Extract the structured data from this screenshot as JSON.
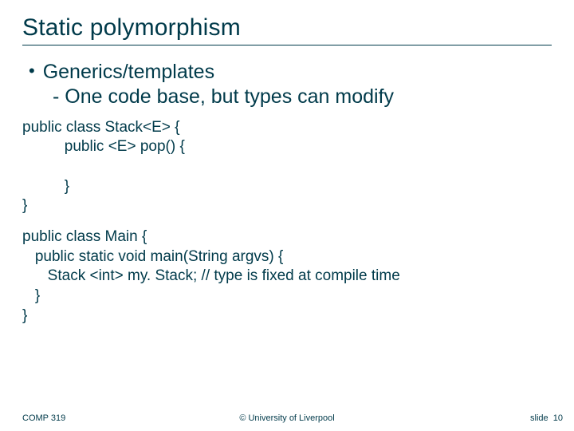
{
  "title": "Static polymorphism",
  "bullet": {
    "main": "Generics/templates",
    "sub_prefix": "- ",
    "sub": "One code base, but types can modify"
  },
  "code1_l1": "public class Stack<E> {",
  "code1_l2": "          public <E> pop() {",
  "code1_l3": "",
  "code1_l4": "          }",
  "code1_l5": "}",
  "code2_l1": "public class Main {",
  "code2_l2": "   public static void main(String argvs) {",
  "code2_l3": "      Stack <int> my. Stack; // type is fixed at compile time",
  "code2_l4": "   }",
  "code2_l5": "}",
  "footer": {
    "left": "COMP 319",
    "center": "© University of Liverpool",
    "right_label": "slide",
    "right_num": "10"
  }
}
